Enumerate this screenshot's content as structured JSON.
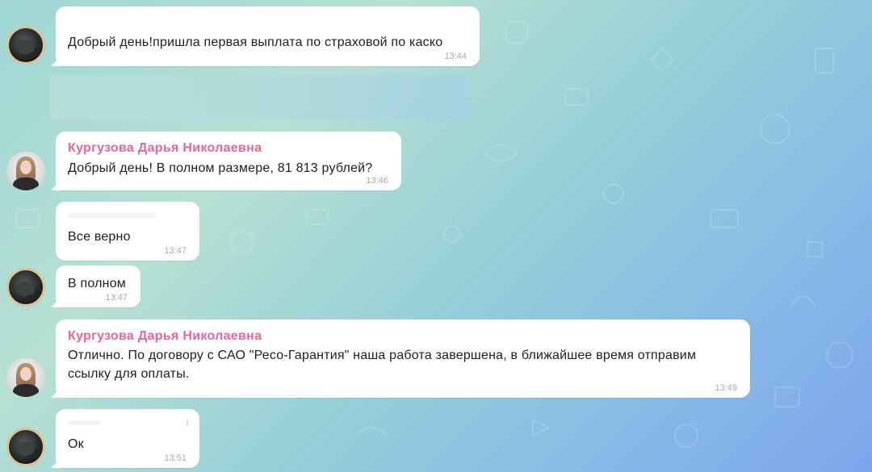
{
  "messages": [
    {
      "sender": "",
      "text": "Добрый день!пришла первая выплата по страховой по каско",
      "time": "13:44"
    },
    {
      "sender": "Кургузова Дарья Николаевна",
      "text": "Добрый день! В полном размере, 81 813 рублей?",
      "time": "13:46"
    },
    {
      "sender": "",
      "text": "Все верно",
      "time": "13:47"
    },
    {
      "sender": "",
      "text": "В полном",
      "time": "13:47"
    },
    {
      "sender": "Кургузова Дарья Николаевна",
      "text_line1": "Отлично. По договору с САО \"Ресо-Гарантия\" наша работа завершена, в ближайшее время отправим",
      "text_line2": "ссылку для оплаты.",
      "time": "13:49"
    },
    {
      "sender": "",
      "text": "Ок",
      "time": "13:51"
    }
  ],
  "colors": {
    "sender_name": "#e8679a",
    "bubble": "#ffffff",
    "timestamp": "#a6aab0"
  }
}
